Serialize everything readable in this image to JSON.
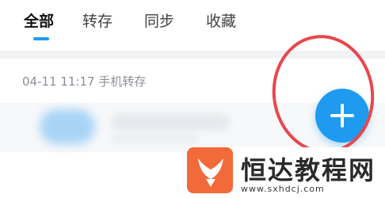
{
  "tabs": [
    {
      "label": "全部",
      "active": true
    },
    {
      "label": "转存",
      "active": false
    },
    {
      "label": "同步",
      "active": false
    },
    {
      "label": "收藏",
      "active": false
    }
  ],
  "group_header": "04-11 11:17  手机转存",
  "fab": {
    "icon": "plus-icon"
  },
  "watermark": {
    "title": "恒达教程网",
    "url": "www.sxhdcj.com"
  },
  "colors": {
    "accent": "#1e9bf0",
    "highlight": "#e8474d",
    "watermark_logo": "#f26a3a"
  }
}
